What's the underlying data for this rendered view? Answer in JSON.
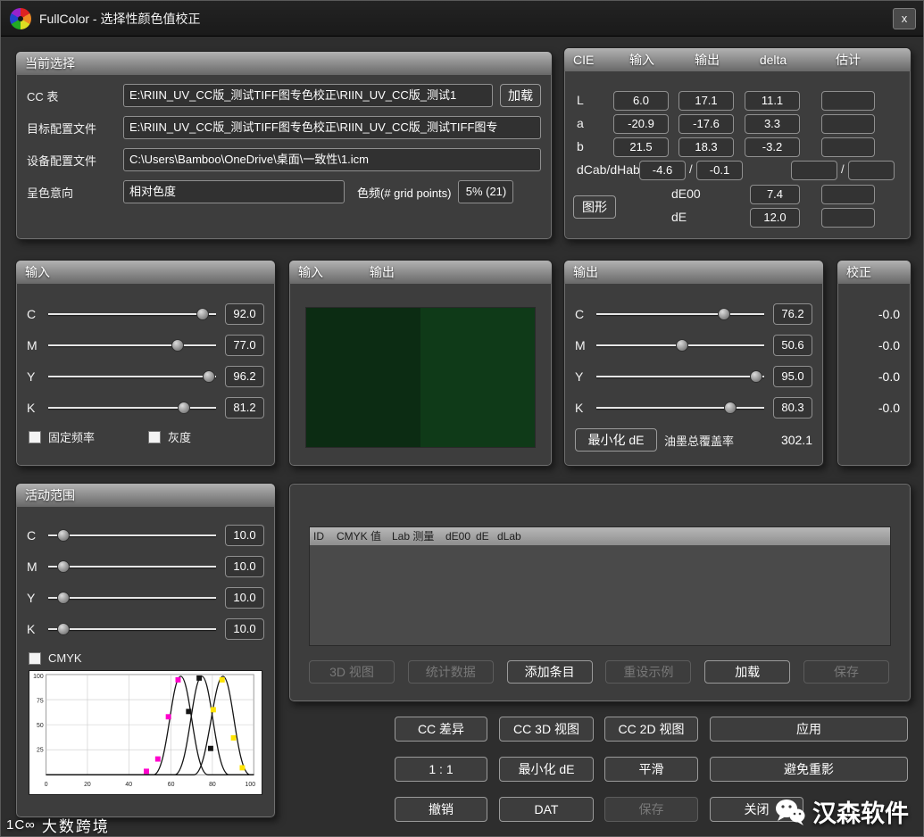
{
  "window": {
    "title": "FullColor - 选择性颜色值校正",
    "close_label": "x"
  },
  "current_selection": {
    "title": "当前选择",
    "cc_table_label": "CC 表",
    "cc_table_value": "E:\\RIIN_UV_CC版_测试TIFF图专色校正\\RIIN_UV_CC版_测试1",
    "load_button": "加载",
    "target_profile_label": "目标配置文件",
    "target_profile_value": "E:\\RIIN_UV_CC版_测试TIFF图专色校正\\RIIN_UV_CC版_测试TIFF图专",
    "device_profile_label": "设备配置文件",
    "device_profile_value": "C:\\Users\\Bamboo\\OneDrive\\桌面\\一致性\\1.icm",
    "intent_label": "呈色意向",
    "intent_value": "相对色度",
    "grid_label": "色频(# grid points)",
    "grid_value": "5% (21)"
  },
  "cie": {
    "title": "CIE",
    "col_input": "输入",
    "col_output": "输出",
    "col_delta": "delta",
    "col_est": "估计",
    "rows": [
      {
        "label": "L",
        "input": "6.0",
        "output": "17.1",
        "delta": "11.1",
        "est": ""
      },
      {
        "label": "a",
        "input": "-20.9",
        "output": "-17.6",
        "delta": "3.3",
        "est": ""
      },
      {
        "label": "b",
        "input": "21.5",
        "output": "18.3",
        "delta": "-3.2",
        "est": ""
      }
    ],
    "dcab_label": "dCab/dHab",
    "dcab_input": "-4.6",
    "dhab_input": "-0.1",
    "slash": "/",
    "graph_button": "图形",
    "de00_label": "dE00",
    "de00_value": "7.4",
    "de_label": "dE",
    "de_value": "12.0"
  },
  "input_group": {
    "title": "输入",
    "sliders": [
      {
        "label": "C",
        "value": "92.0",
        "pos": 92
      },
      {
        "label": "M",
        "value": "77.0",
        "pos": 77
      },
      {
        "label": "Y",
        "value": "96.2",
        "pos": 96
      },
      {
        "label": "K",
        "value": "81.2",
        "pos": 81
      }
    ],
    "checkbox_fixed": "固定频率",
    "checkbox_gray": "灰度"
  },
  "preview": {
    "input_label": "输入",
    "output_label": "输出",
    "input_color": "#0c2c13",
    "output_color": "#0f3a18"
  },
  "output_group": {
    "title": "输出",
    "sliders": [
      {
        "label": "C",
        "value": "76.2",
        "pos": 76
      },
      {
        "label": "M",
        "value": "50.6",
        "pos": 51
      },
      {
        "label": "Y",
        "value": "95.0",
        "pos": 95
      },
      {
        "label": "K",
        "value": "80.3",
        "pos": 80
      }
    ],
    "minimize_button": "最小化 dE",
    "ink_label": "油墨总覆盖率",
    "ink_value": "302.1"
  },
  "correction": {
    "title": "校正",
    "values": [
      "-0.0",
      "-0.0",
      "-0.0",
      "-0.0"
    ]
  },
  "active_range": {
    "title": "活动范围",
    "sliders": [
      {
        "label": "C",
        "value": "10.0",
        "pos": 9
      },
      {
        "label": "M",
        "value": "10.0",
        "pos": 9
      },
      {
        "label": "Y",
        "value": "10.0",
        "pos": 9
      },
      {
        "label": "K",
        "value": "10.0",
        "pos": 9
      }
    ],
    "checkbox": "CMYK",
    "graph": {
      "x_ticks": [
        "0",
        "20",
        "40",
        "60",
        "80",
        "100"
      ],
      "y_ticks": [
        "100",
        "75",
        "50",
        "25"
      ],
      "marker_colors": [
        "#ff00cc",
        "#151515",
        "#ffe400"
      ]
    }
  },
  "table": {
    "headers": [
      "ID",
      "CMYK 值",
      "Lab 测量",
      "dE00",
      "dE",
      "dLab"
    ],
    "buttons": [
      "3D 视图",
      "统计数据",
      "添加条目",
      "重设示例",
      "加载",
      "保存"
    ]
  },
  "actions": {
    "cc_diff": "CC 差异",
    "cc_3d": "CC 3D 视图",
    "cc_2d": "CC 2D 视图",
    "apply": "应用",
    "one_to_one": "1 : 1",
    "min_de": "最小化 dE",
    "smooth": "平滑",
    "avoid_ghost": "避免重影",
    "undo": "撤销",
    "dat": "DAT",
    "save": "保存",
    "close": "关闭"
  },
  "watermarks": {
    "left_logo": "1C∞",
    "left_text": "大数跨境",
    "right_text": "汉森软件"
  }
}
